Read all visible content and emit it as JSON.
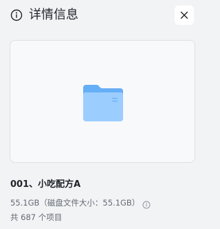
{
  "header": {
    "title": "详情信息"
  },
  "item": {
    "name": "001、小吃配方A",
    "size": "55.1GB（磁盘文件大小：55.1GB）",
    "count": "共 687 个项目"
  },
  "icons": {
    "info": "info-icon",
    "close": "close-icon",
    "folder": "folder-icon",
    "size_info": "info-icon"
  },
  "colors": {
    "background": "#f2f3f5",
    "card": "#f8f9fb",
    "folder_back": "#66aef6",
    "folder_front": "#9ccdff",
    "text_primary": "#1f2329",
    "text_secondary": "#646a73"
  }
}
